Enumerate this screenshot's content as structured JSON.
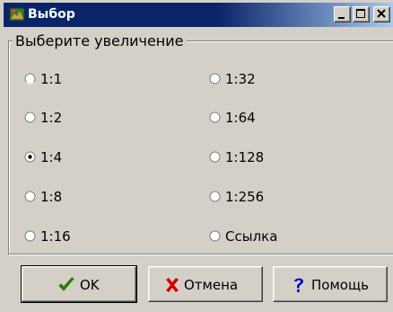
{
  "window": {
    "title": "Выбор",
    "controls": [
      "minimize-icon",
      "maximize-icon",
      "close-icon"
    ]
  },
  "group": {
    "legend": "Выберите увеличение"
  },
  "options": {
    "o1": "1:1",
    "o2": "1:2",
    "o3": "1:4",
    "o4": "1:8",
    "o5": "1:16",
    "o6": "1:32",
    "o7": "1:64",
    "o8": "1:128",
    "o9": "1:256",
    "o10": "Ссылка",
    "selected": "1:4"
  },
  "buttons": {
    "ok": "OK",
    "cancel": "Отмена",
    "help": "Помощь"
  },
  "colors": {
    "titlebar_start": "#0a246a",
    "titlebar_end": "#a6caf0",
    "face": "#d4d0c8",
    "ok_icon": "#2e8b00",
    "cancel_icon": "#d40000",
    "help_icon": "#0000c8"
  }
}
